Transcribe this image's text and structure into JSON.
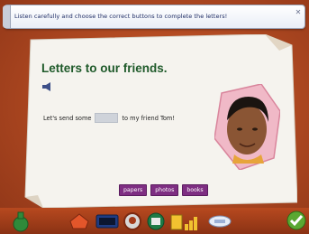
{
  "banner": {
    "instruction": "Listen carefully and choose the correct buttons to complete the letters!"
  },
  "lesson": {
    "title": "Letters to our friends.",
    "sentence_before": "Let's send some",
    "sentence_after": "to my friend Tom!"
  },
  "choices": [
    "papers",
    "photos",
    "books"
  ],
  "toolbar": {
    "icons": [
      "potion-icon",
      "home-icon",
      "score-icon",
      "face-icon",
      "book-icon",
      "bar-chart-icon",
      "tools-icon",
      "check-icon"
    ]
  },
  "colors": {
    "title": "#1f5a2a",
    "choice_button": "#7e2e82",
    "background": "#b14a22"
  }
}
